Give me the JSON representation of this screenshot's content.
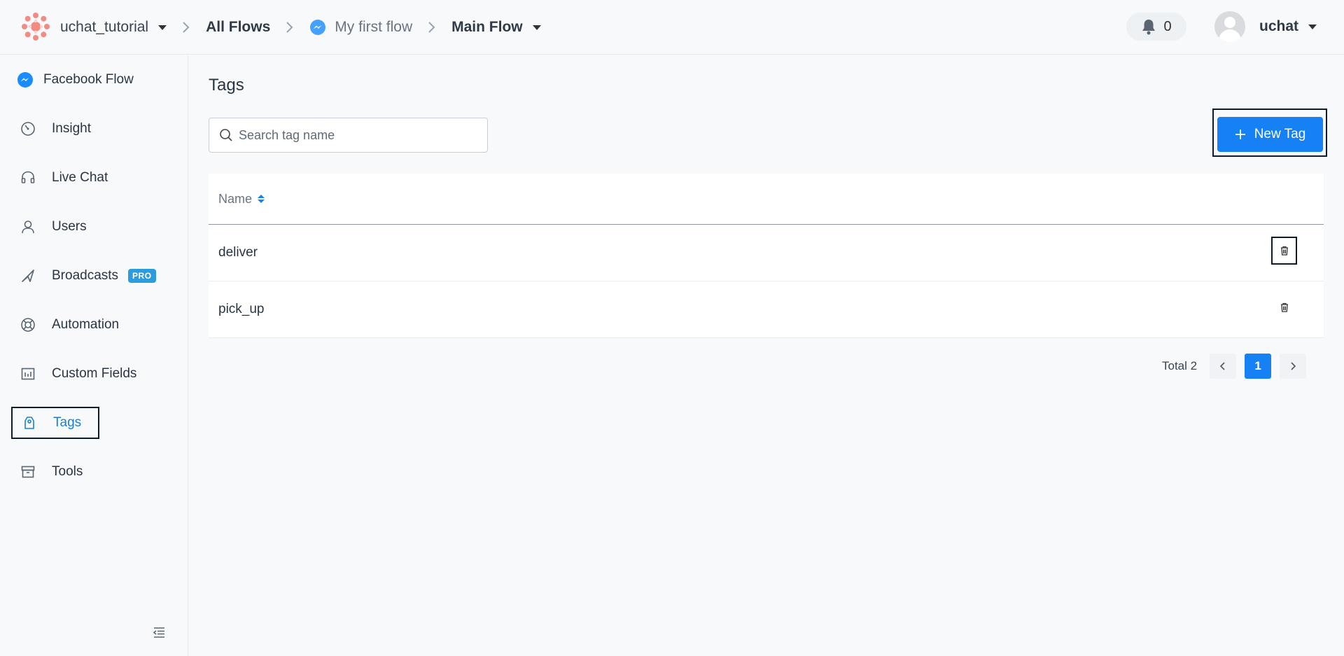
{
  "header": {
    "workspace": "uchat_tutorial",
    "breadcrumb_all_flows": "All Flows",
    "breadcrumb_flow": "My first flow",
    "breadcrumb_subflow": "Main Flow",
    "notification_count": "0",
    "user_name": "uchat"
  },
  "sidebar": {
    "items": [
      {
        "label": "Facebook Flow",
        "icon": "messenger-icon"
      },
      {
        "label": "Insight",
        "icon": "gauge-icon"
      },
      {
        "label": "Live Chat",
        "icon": "headset-icon"
      },
      {
        "label": "Users",
        "icon": "user-icon"
      },
      {
        "label": "Broadcasts",
        "icon": "megaphone-icon",
        "badge": "PRO"
      },
      {
        "label": "Automation",
        "icon": "lifebuoy-icon"
      },
      {
        "label": "Custom Fields",
        "icon": "fields-icon"
      },
      {
        "label": "Tags",
        "icon": "tag-icon",
        "active": true
      },
      {
        "label": "Tools",
        "icon": "toolbox-icon"
      }
    ]
  },
  "main": {
    "title": "Tags",
    "search": {
      "placeholder": "Search tag name",
      "value": ""
    },
    "new_tag_label": "New Tag",
    "table": {
      "columns": [
        "Name"
      ],
      "rows": [
        {
          "name": "deliver"
        },
        {
          "name": "pick_up"
        }
      ]
    },
    "pagination": {
      "total_label": "Total 2",
      "current_page": "1"
    }
  },
  "colors": {
    "accent": "#1581f4",
    "messenger": "#1a8cff",
    "pro_badge": "#2d9cdb",
    "logo": "#f26d6d"
  }
}
